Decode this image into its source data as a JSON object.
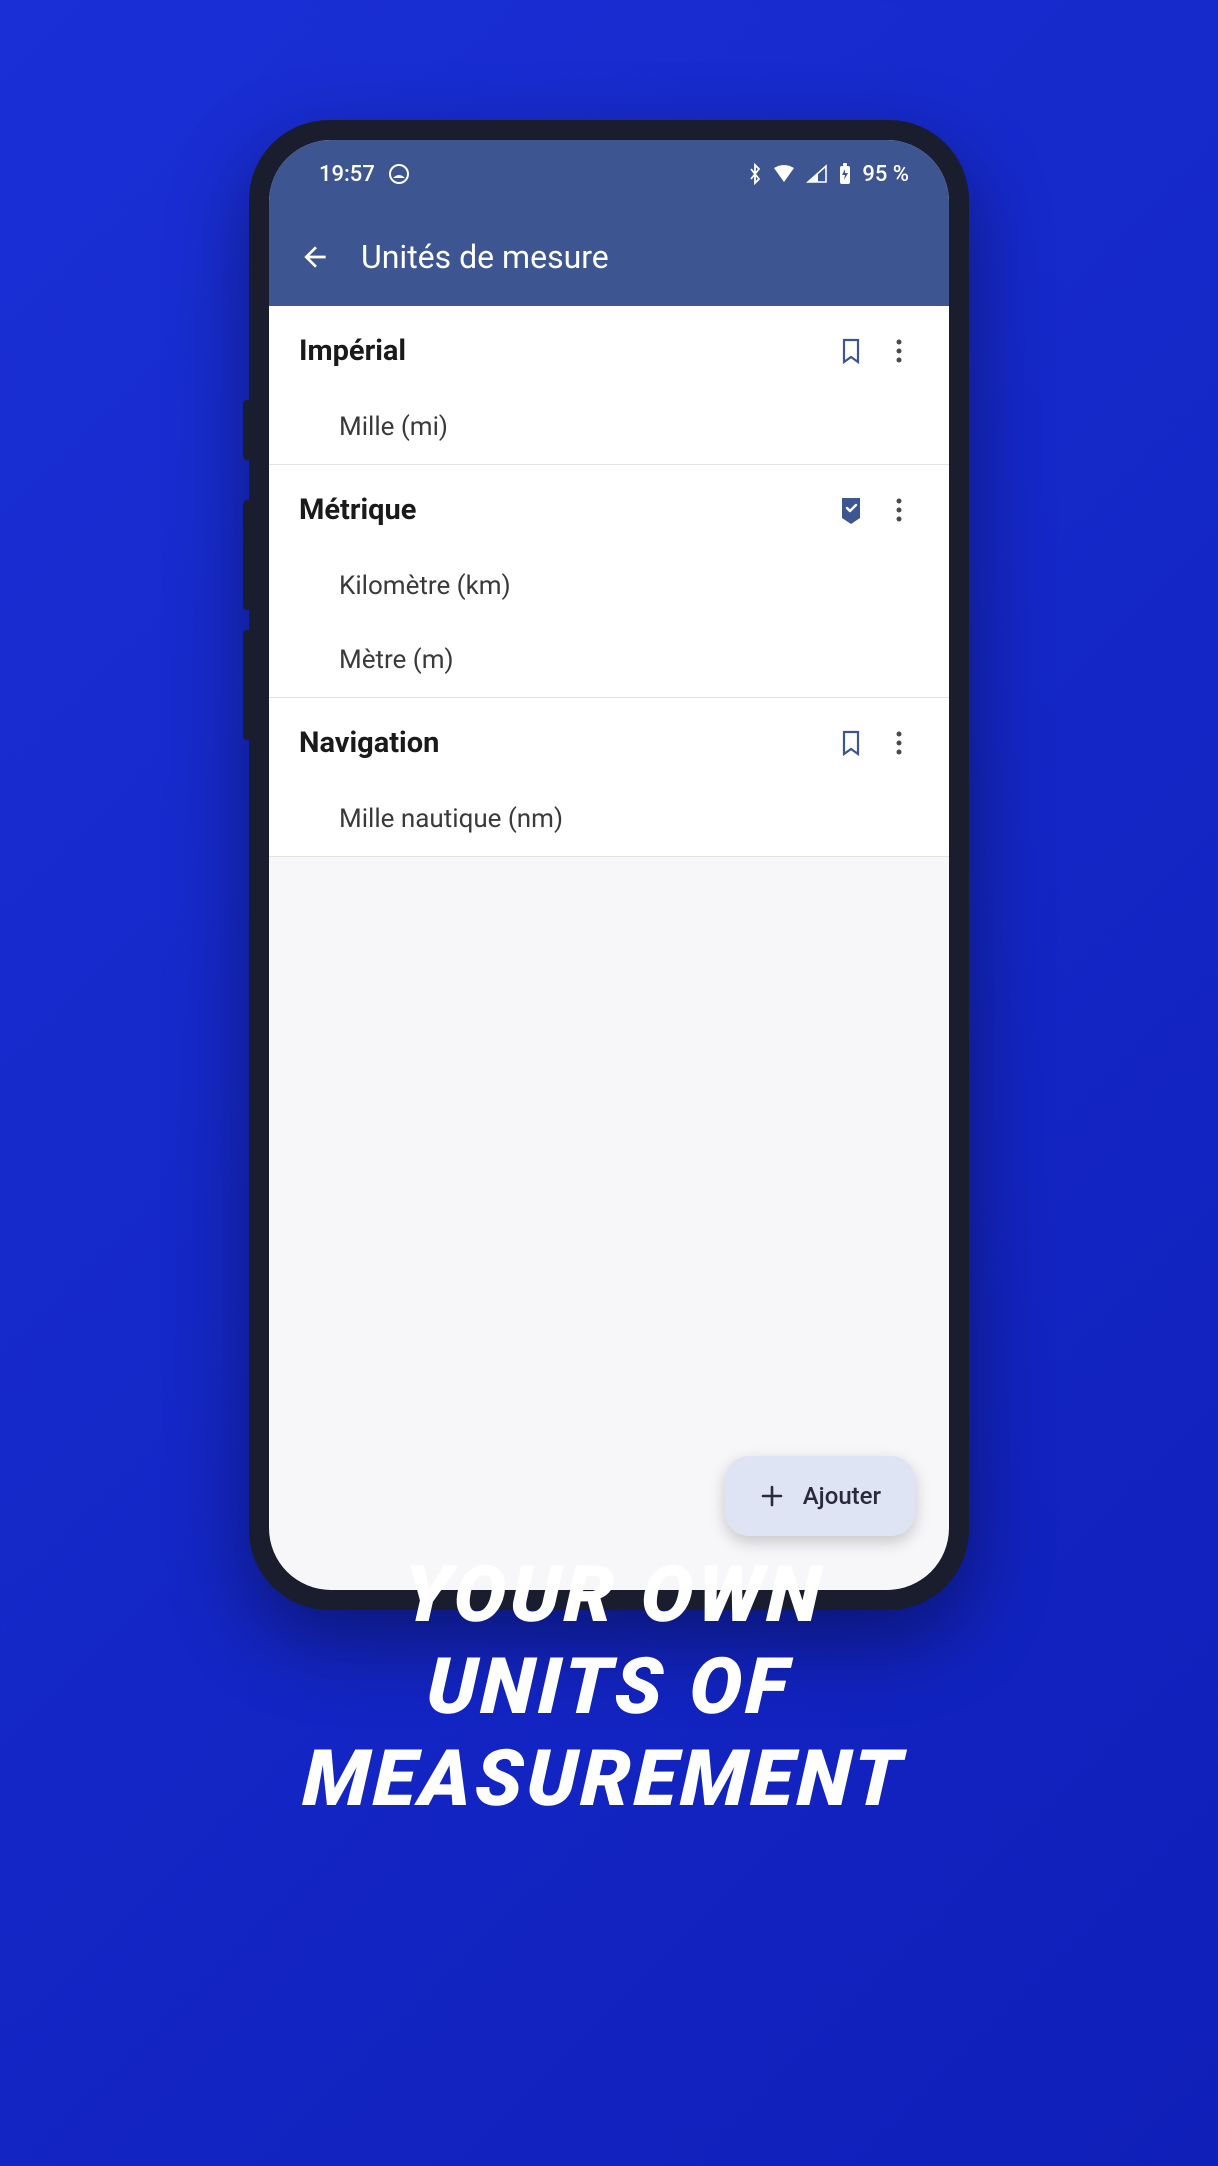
{
  "status_bar": {
    "time": "19:57",
    "battery": "95 %"
  },
  "app_bar": {
    "title": "Unités de mesure"
  },
  "groups": [
    {
      "title": "Impérial",
      "selected": false,
      "items": [
        "Mille (mi)"
      ]
    },
    {
      "title": "Métrique",
      "selected": true,
      "items": [
        "Kilomètre (km)",
        "Mètre (m)"
      ]
    },
    {
      "title": "Navigation",
      "selected": false,
      "items": [
        "Mille nautique (nm)"
      ]
    }
  ],
  "fab": {
    "label": "Ajouter"
  },
  "tagline": {
    "line1": "YOUR OWN",
    "line2": "UNITS OF",
    "line3": "MEASUREMENT"
  }
}
